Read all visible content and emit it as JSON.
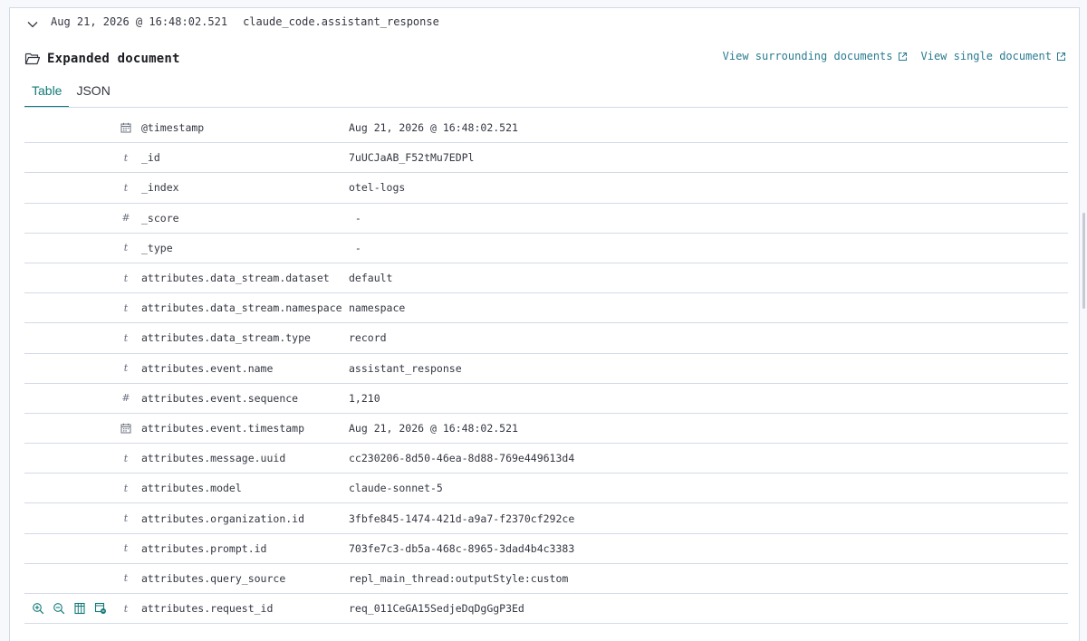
{
  "header": {
    "timestamp": "Aug 21, 2026 @ 16:48:02.521",
    "message": "claude_code.assistant_response",
    "expand_icon": "chevron-down-icon"
  },
  "document": {
    "title": "Expanded document",
    "title_icon": "folder-open-icon",
    "links": [
      {
        "label": "View surrounding documents",
        "icon": "external-link-icon"
      },
      {
        "label": "View single document",
        "icon": "external-link-icon"
      }
    ]
  },
  "tabs": [
    {
      "label": "Table",
      "active": true
    },
    {
      "label": "JSON",
      "active": false
    }
  ],
  "accent_color": "#117a78",
  "rows": [
    {
      "type": "date",
      "field": "@timestamp",
      "value": "Aug 21, 2026 @ 16:48:02.521"
    },
    {
      "type": "string",
      "field": "_id",
      "value": "7uUCJaAB_F52tMu7EDPl"
    },
    {
      "type": "string",
      "field": "_index",
      "value": "otel-logs"
    },
    {
      "type": "number",
      "field": "_score",
      "value": " -"
    },
    {
      "type": "string",
      "field": "_type",
      "value": " -"
    },
    {
      "type": "string",
      "field": "attributes.data_stream.dataset",
      "value": "default"
    },
    {
      "type": "string",
      "field": "attributes.data_stream.namespace",
      "value": "namespace"
    },
    {
      "type": "string",
      "field": "attributes.data_stream.type",
      "value": "record"
    },
    {
      "type": "string",
      "field": "attributes.event.name",
      "value": "assistant_response"
    },
    {
      "type": "number",
      "field": "attributes.event.sequence",
      "value": "1,210"
    },
    {
      "type": "date",
      "field": "attributes.event.timestamp",
      "value": "Aug 21, 2026 @ 16:48:02.521"
    },
    {
      "type": "string",
      "field": "attributes.message.uuid",
      "value": "cc230206-8d50-46ea-8d88-769e449613d4"
    },
    {
      "type": "string",
      "field": "attributes.model",
      "value": "claude-sonnet-5"
    },
    {
      "type": "string",
      "field": "attributes.organization.id",
      "value": "3fbfe845-1474-421d-a9a7-f2370cf292ce"
    },
    {
      "type": "string",
      "field": "attributes.prompt.id",
      "value": "703fe7c3-db5a-468c-8965-3dad4b4c3383"
    },
    {
      "type": "string",
      "field": "attributes.query_source",
      "value": "repl_main_thread:outputStyle:custom"
    },
    {
      "type": "string",
      "field": "attributes.request_id",
      "value": "req_011CeGA15SedjeDqDgGgP3Ed",
      "hovered": true
    }
  ],
  "type_glyphs": {
    "string": "t",
    "number": "#"
  },
  "row_actions": [
    "filter-for-value-icon",
    "filter-out-value-icon",
    "toggle-column-icon",
    "filter-exists-icon"
  ]
}
